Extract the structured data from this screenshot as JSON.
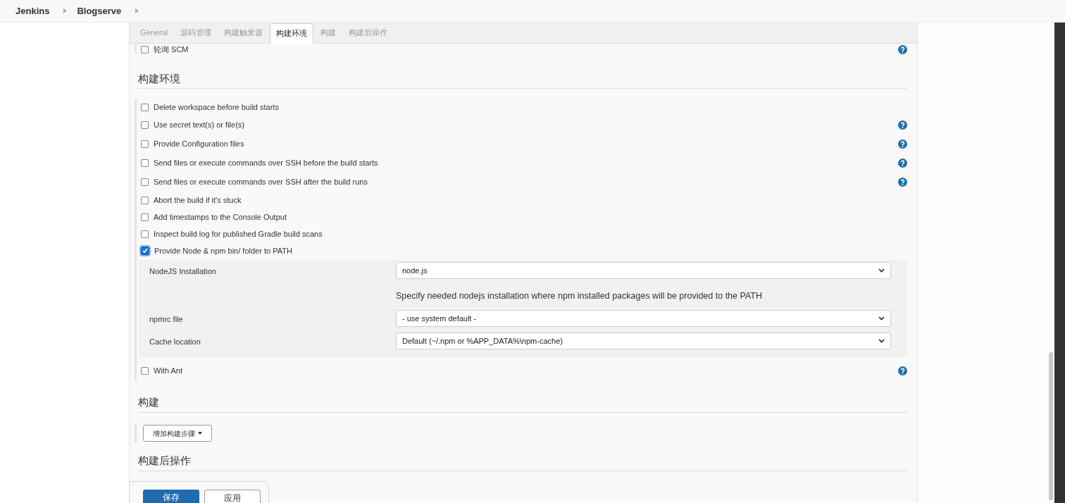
{
  "breadcrumbs": [
    {
      "label": "Jenkins"
    },
    {
      "label": "Blogserve"
    }
  ],
  "tabs": [
    {
      "label": "General",
      "selected": false
    },
    {
      "label": "源码管理",
      "selected": false
    },
    {
      "label": "构建触发器",
      "selected": false
    },
    {
      "label": "构建环境",
      "selected": true
    },
    {
      "label": "构建",
      "selected": false
    },
    {
      "label": "构建后操作",
      "selected": false
    }
  ],
  "top_option": {
    "label": "轮询 SCM",
    "checked": false,
    "help": true
  },
  "build_environment": {
    "title": "构建环境",
    "options": [
      {
        "label": "Delete workspace before build starts",
        "checked": false,
        "help": false
      },
      {
        "label": "Use secret text(s) or file(s)",
        "checked": false,
        "help": true
      },
      {
        "label": "Provide Configuration files",
        "checked": false,
        "help": true
      },
      {
        "label": "Send files or execute commands over SSH before the build starts",
        "checked": false,
        "help": true
      },
      {
        "label": "Send files or execute commands over SSH after the build runs",
        "checked": false,
        "help": true
      },
      {
        "label": "Abort the build if it's stuck",
        "checked": false,
        "help": false
      },
      {
        "label": "Add timestamps to the Console Output",
        "checked": false,
        "help": false
      },
      {
        "label": "Inspect build log for published Gradle build scans",
        "checked": false,
        "help": false
      },
      {
        "label": "Provide Node & npm bin/ folder to PATH",
        "checked": true,
        "help": false,
        "settings": [
          {
            "label": "NodeJS Installation",
            "value": "node.js",
            "description": "Specify needed nodejs installation where npm installed packages will be provided to the PATH"
          },
          {
            "label": "npmrc file",
            "value": "- use system default -"
          },
          {
            "label": "Cache location",
            "value": "Default (~/.npm or %APP_DATA%\\npm-cache)"
          }
        ]
      },
      {
        "label": "With Ant",
        "checked": false,
        "help": true
      }
    ]
  },
  "build": {
    "title": "构建",
    "add_button": "增加构建步骤"
  },
  "post_build": {
    "title": "构建后操作"
  },
  "actions": [
    {
      "label": "保存",
      "kind": "primary"
    },
    {
      "label": "应用",
      "kind": "secondary"
    }
  ]
}
